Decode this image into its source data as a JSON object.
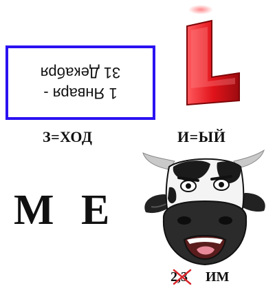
{
  "calendar": {
    "line1": "1 Января -",
    "line2": "31 Декабря"
  },
  "clues": {
    "left": "З=ХОД",
    "right": "И=ЫЙ"
  },
  "letters": {
    "m": "М",
    "e": "Е"
  },
  "bottom": {
    "digits": "2,3",
    "suffix": "ИМ"
  },
  "colors": {
    "frame": "#2a12f2",
    "glyph_red": "#e1131a",
    "cross_red": "#d9262b"
  },
  "icons": [
    "red-glyph-icon",
    "cow-head-icon",
    "red-cross-icon"
  ]
}
